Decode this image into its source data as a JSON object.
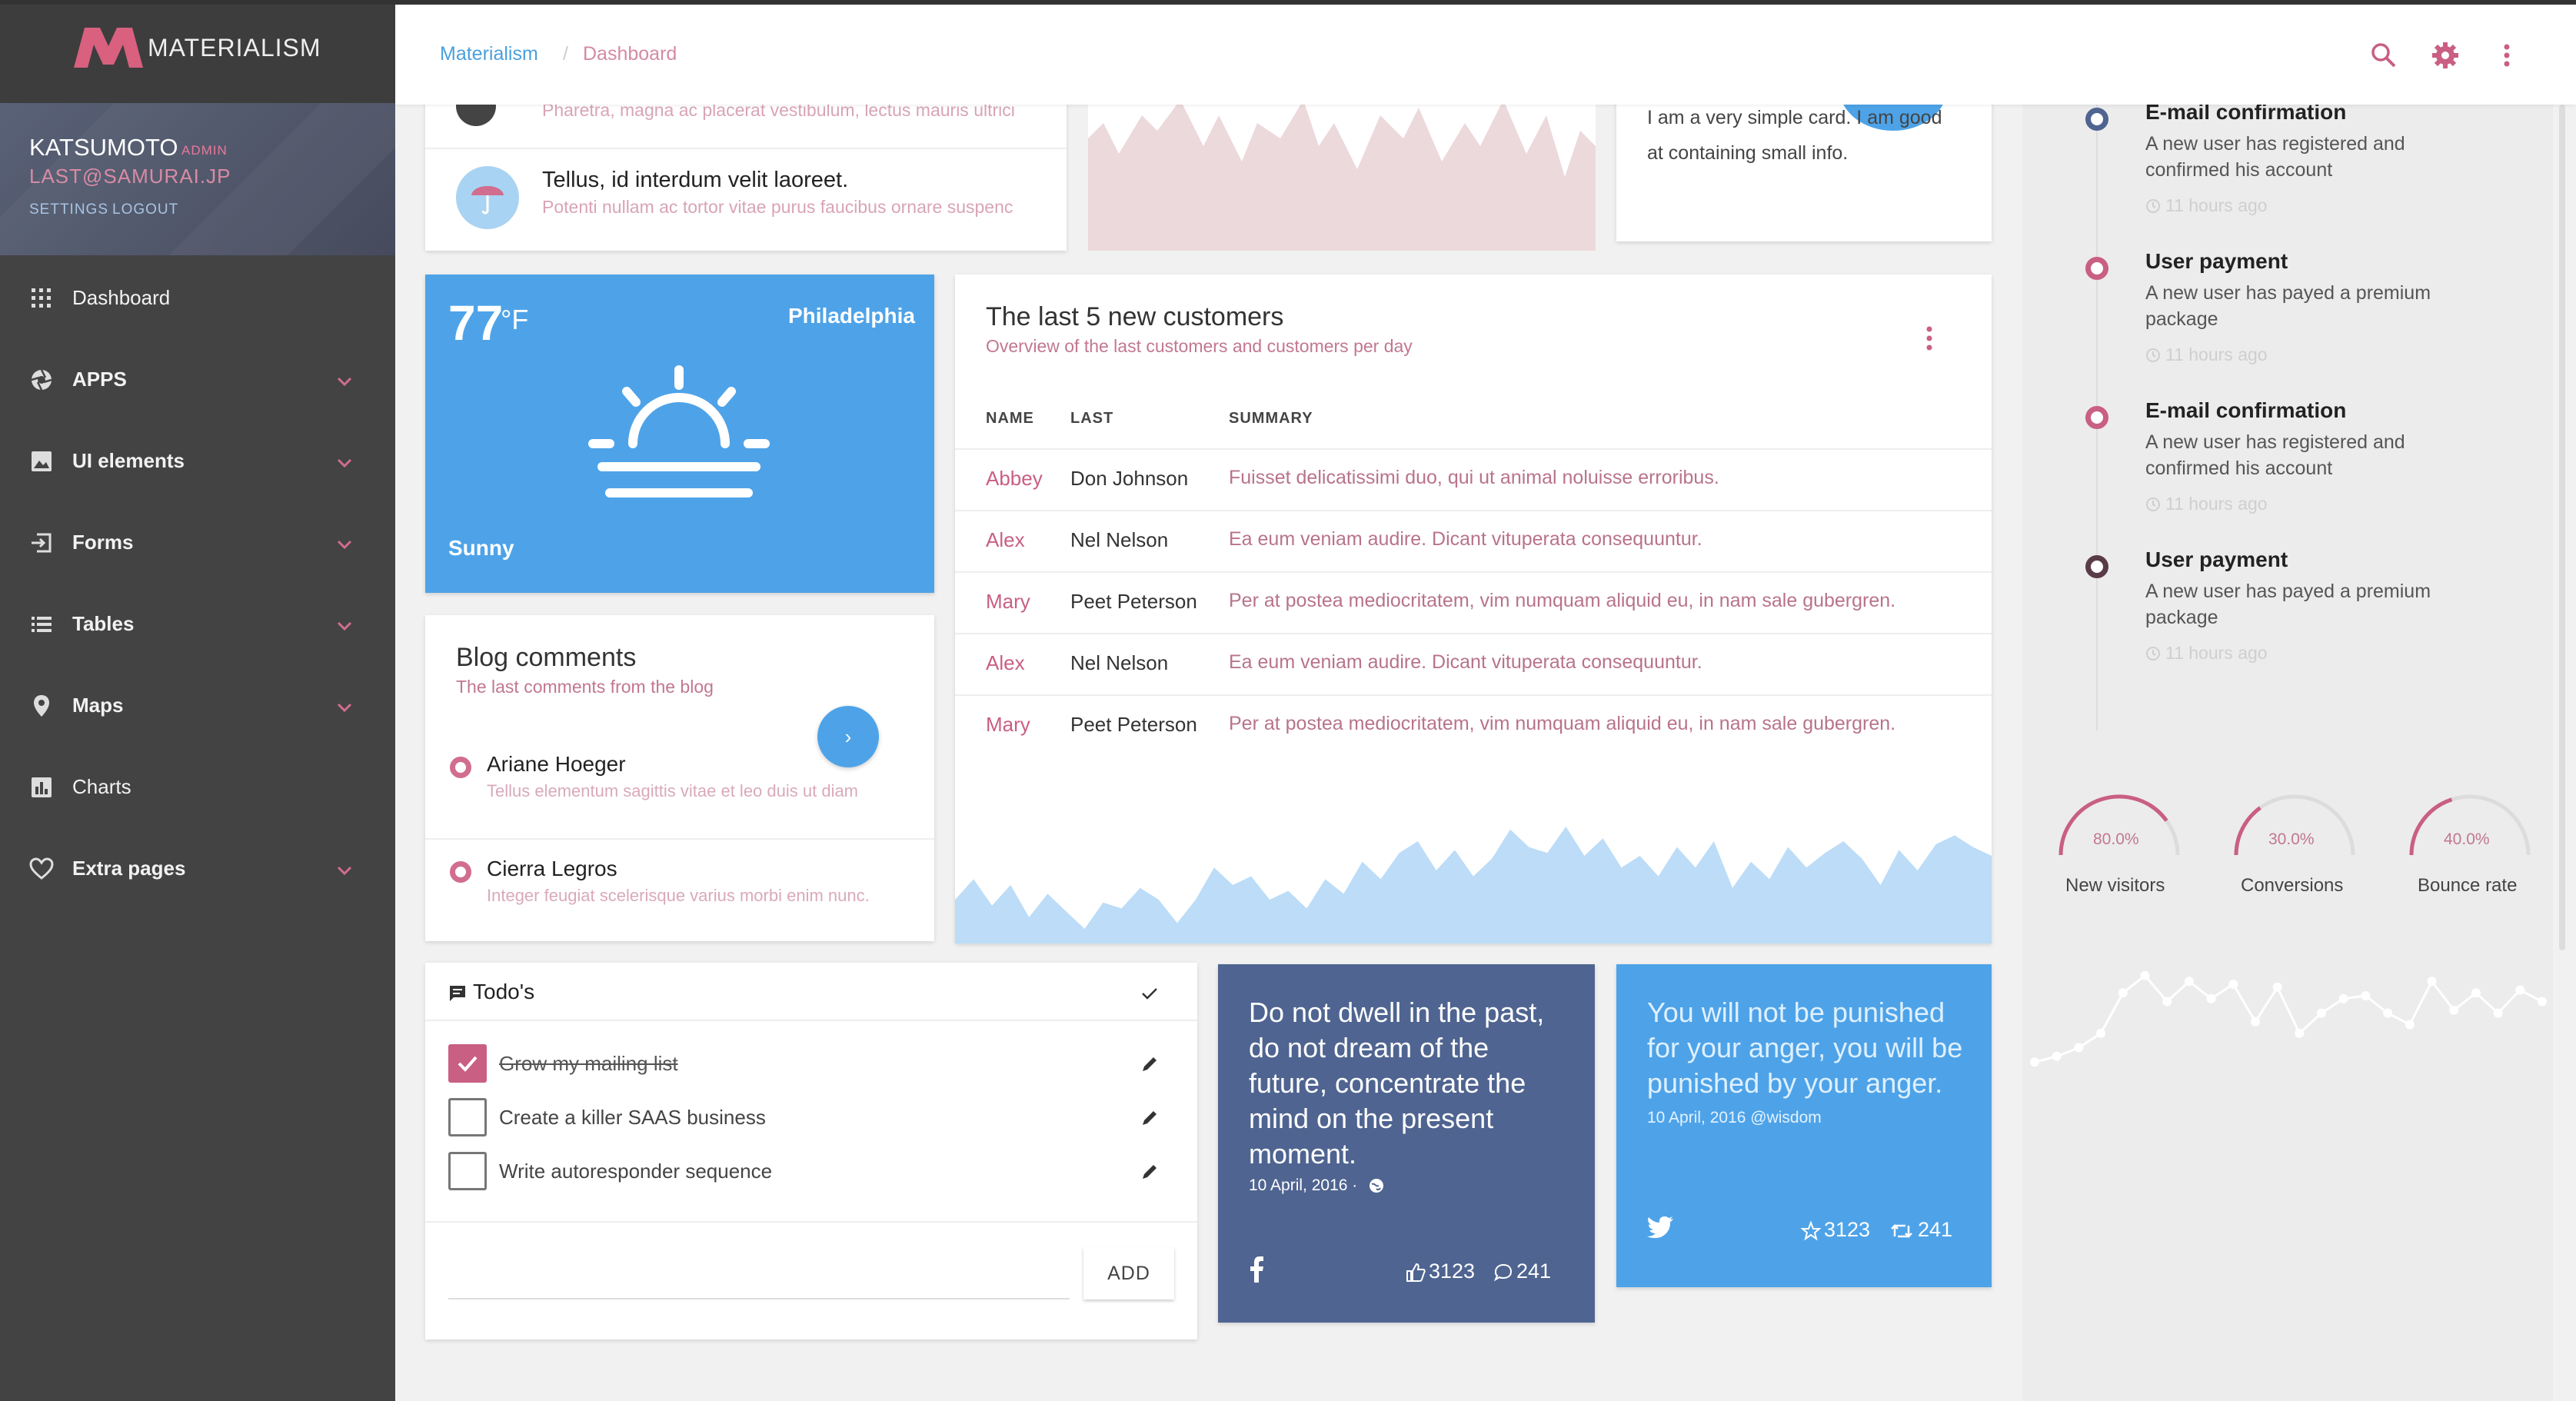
{
  "app": {
    "name": "MATERIALISM"
  },
  "user": {
    "name": "KATSUMOTO",
    "role": "ADMIN",
    "email": "LAST@SAMURAI.JP",
    "settings_label": "SETTINGS",
    "logout_label": "LOGOUT"
  },
  "nav": {
    "items": [
      {
        "label": "Dashboard",
        "icon": "dashboard-grid-icon",
        "has_children": false
      },
      {
        "label": "APPS",
        "icon": "aperture-icon",
        "has_children": true
      },
      {
        "label": "UI elements",
        "icon": "image-icon",
        "has_children": true
      },
      {
        "label": "Forms",
        "icon": "login-arrow-icon",
        "has_children": true
      },
      {
        "label": "Tables",
        "icon": "list-icon",
        "has_children": true
      },
      {
        "label": "Maps",
        "icon": "map-pin-icon",
        "has_children": true
      },
      {
        "label": "Charts",
        "icon": "bar-chart-icon",
        "has_children": false
      },
      {
        "label": "Extra pages",
        "icon": "heart-icon",
        "has_children": true
      }
    ]
  },
  "breadcrumb": {
    "home": "Materialism",
    "separator": "/",
    "current": "Dashboard"
  },
  "messages": {
    "partial_text": "Pharetra, magna ac placerat vestibulum, lectus mauris ultrici",
    "item": {
      "title": "Tellus, id interdum velit laoreet.",
      "text": "Potenti nullam ac tortor vitae purus faucibus ornare suspenc"
    }
  },
  "simple_card": {
    "text": "I am a very simple card. I am good at containing small info."
  },
  "weather": {
    "temp": "77",
    "unit": "°F",
    "city": "Philadelphia",
    "condition": "Sunny"
  },
  "blog": {
    "title": "Blog comments",
    "subtitle": "The last comments from the blog",
    "button": "›",
    "comments": [
      {
        "name": "Ariane Hoeger",
        "text": "Tellus elementum sagittis vitae et leo duis ut diam"
      },
      {
        "name": "Cierra Legros",
        "text": "Integer feugiat scelerisque varius morbi enim nunc."
      }
    ]
  },
  "customers": {
    "title": "The last 5 new customers",
    "subtitle": "Overview of the last customers and customers per day",
    "columns": [
      "NAME",
      "LAST",
      "SUMMARY"
    ],
    "rows": [
      {
        "first": "Abbey",
        "last": "Don Johnson",
        "summary": "Fuisset delicatissimi duo, qui ut animal noluisse erroribus."
      },
      {
        "first": "Alex",
        "last": "Nel Nelson",
        "summary": "Ea eum veniam audire. Dicant vituperata consequuntur."
      },
      {
        "first": "Mary",
        "last": "Peet Peterson",
        "summary": "Per at postea mediocritatem, vim numquam aliquid eu, in nam sale gubergren."
      },
      {
        "first": "Alex",
        "last": "Nel Nelson",
        "summary": "Ea eum veniam audire. Dicant vituperata consequuntur."
      },
      {
        "first": "Mary",
        "last": "Peet Peterson",
        "summary": "Per at postea mediocritatem, vim numquam aliquid eu, in nam sale gubergren."
      }
    ],
    "sparkline": [
      30,
      44,
      26,
      40,
      18,
      34,
      22,
      10,
      28,
      24,
      38,
      30,
      14,
      30,
      52,
      40,
      46,
      30,
      36,
      24,
      44,
      34,
      56,
      44,
      62,
      70,
      50,
      64,
      46,
      58,
      78,
      66,
      62,
      80,
      60,
      72,
      52,
      60,
      46,
      66,
      52,
      70,
      38,
      56,
      44,
      66,
      52,
      62,
      70,
      58,
      40,
      64,
      50,
      68,
      74,
      66,
      60
    ]
  },
  "todos": {
    "title": "Todo's",
    "items": [
      {
        "text": "Grow my mailing list",
        "done": true
      },
      {
        "text": "Create a killer SAAS business",
        "done": false
      },
      {
        "text": "Write autoresponder sequence",
        "done": false
      }
    ],
    "add_label": "ADD"
  },
  "quotes": [
    {
      "text": "Do not dwell in the past, do not dream of the future, concentrate the mind on the present moment.",
      "date": "10 April, 2016 ·",
      "likes": "3123",
      "comments": "241",
      "network": "facebook-icon"
    },
    {
      "text": "You will not be punished for your anger, you will be punished by your anger.",
      "date": "10 April, 2016 @wisdom",
      "stars": "3123",
      "retweets": "241",
      "network": "twitter-icon"
    }
  ],
  "timeline": [
    {
      "title": "E-mail confirmation",
      "text": "A new user has registered and confirmed his account",
      "time": "11 hours ago",
      "color": "#4f6490"
    },
    {
      "title": "User payment",
      "text": "A new user has payed a premium package",
      "time": "11 hours ago",
      "color": "#c95f82"
    },
    {
      "title": "E-mail confirmation",
      "text": "A new user has registered and confirmed his account",
      "time": "11 hours ago",
      "color": "#c95f82"
    },
    {
      "title": "User payment",
      "text": "A new user has payed a premium package",
      "time": "11 hours ago",
      "color": "#5a3b48"
    }
  ],
  "gauges": [
    {
      "label": "New visitors",
      "value_text": "80.0%",
      "value": 80
    },
    {
      "label": "Conversions",
      "value_text": "30.0%",
      "value": 30
    },
    {
      "label": "Bounce rate",
      "value_text": "40.0%",
      "value": 40
    }
  ],
  "stats_line": [
    10,
    14,
    20,
    30,
    58,
    70,
    52,
    66,
    54,
    64,
    38,
    62,
    30,
    44,
    54,
    56,
    44,
    36,
    66,
    46,
    58,
    44,
    60,
    52
  ],
  "colors": {
    "accent": "#c95f82",
    "blue": "#4ea3e8",
    "navy": "#4f6490"
  }
}
